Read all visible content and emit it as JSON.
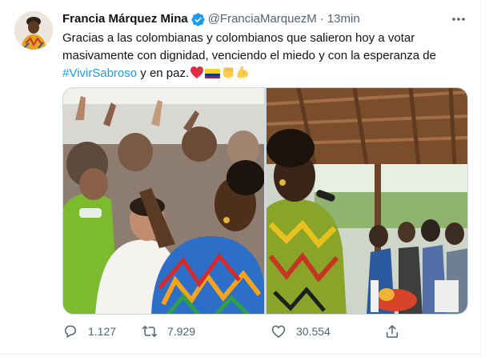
{
  "tweet": {
    "author": {
      "name": "Francia Márquez Mina",
      "handle": "@FranciaMarquezM",
      "verified": true,
      "avatar_icon": "profile-photo"
    },
    "separator": "·",
    "time": "13min",
    "text_part1": "Gracias a las colombianas y colombianos que salieron hoy a votar masivamente con dignidad, venciendo el miedo y con la esperanza de",
    "hashtag": "#VivirSabroso",
    "text_part2": "y en paz.",
    "emojis": [
      "red-heart",
      "colombia-flag",
      "raised-fist",
      "flexed-biceps"
    ],
    "media": [
      "photo-crowd-embrace",
      "photo-speaker-pavilion"
    ],
    "actions": {
      "reply": {
        "icon": "reply-icon",
        "count": "1.127"
      },
      "retweet": {
        "icon": "retweet-icon",
        "count": "7.929"
      },
      "like": {
        "icon": "heart-icon",
        "count": "30.554"
      },
      "share": {
        "icon": "share-icon"
      }
    },
    "colors": {
      "text": "#0f1419",
      "secondary": "#536471",
      "link": "#1d9bf0",
      "verified": "#1d9bf0"
    }
  }
}
